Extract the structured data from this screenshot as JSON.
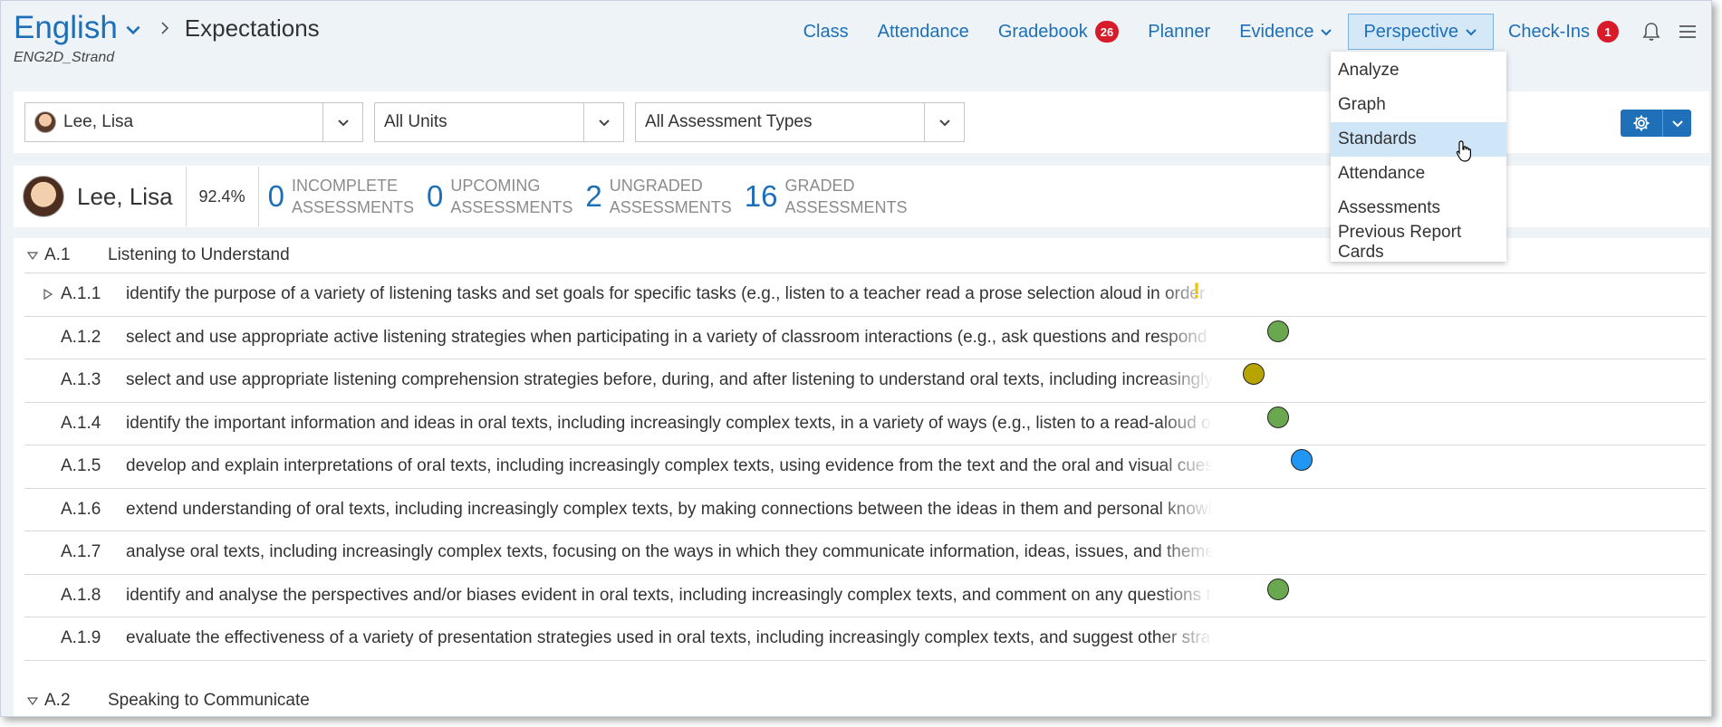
{
  "header": {
    "course_name": "English",
    "page_title": "Expectations",
    "course_code": "ENG2D_Strand"
  },
  "nav": {
    "class": "Class",
    "attendance": "Attendance",
    "gradebook": "Gradebook",
    "gradebook_badge": "26",
    "planner": "Planner",
    "evidence": "Evidence",
    "perspective": "Perspective",
    "checkins": "Check-Ins",
    "checkins_badge": "1"
  },
  "perspective_menu": {
    "items": [
      "Analyze",
      "Graph",
      "Standards",
      "Attendance",
      "Assessments",
      "Previous Report Cards"
    ],
    "selected": "Standards"
  },
  "filters": {
    "student": "Lee, Lisa",
    "units": "All Units",
    "assessment_types": "All Assessment Types"
  },
  "summary": {
    "student_name": "Lee, Lisa",
    "percent": "92.4%",
    "stats": [
      {
        "num": "0",
        "line1": "INCOMPLETE",
        "line2": "ASSESSMENTS"
      },
      {
        "num": "0",
        "line1": "UPCOMING",
        "line2": "ASSESSMENTS"
      },
      {
        "num": "2",
        "line1": "UNGRADED",
        "line2": "ASSESSMENTS"
      },
      {
        "num": "16",
        "line1": "GRADED",
        "line2": "ASSESSMENTS"
      }
    ]
  },
  "strands": [
    {
      "code": "A.1",
      "title": "Listening to Understand"
    },
    {
      "code": "A.2",
      "title": "Speaking to Communicate"
    }
  ],
  "expectations": [
    {
      "code": "A.1.1",
      "expandable": true,
      "text": "identify the purpose of a variety of listening tasks and set goals for specific tasks (e.g., listen to a teacher read a prose selection aloud in order to identify how the",
      "marker": "warning"
    },
    {
      "code": "A.1.2",
      "text": "select and use appropriate active listening strategies when participating in a variety of classroom interactions (e.g., ask questions and respond to the ideas of others",
      "marker": "green"
    },
    {
      "code": "A.1.3",
      "text": "select and use appropriate listening comprehension strategies before, during, and after listening to understand oral texts, including increasingly complex texts (e.g.",
      "marker": "olive"
    },
    {
      "code": "A.1.4",
      "text": "identify the important information and ideas in oral texts, including increasingly complex texts, in a variety of ways (e.g., listen to a read-aloud of a scene from a S",
      "marker": "green"
    },
    {
      "code": "A.1.5",
      "text": "develop and explain interpretations of oral texts, including increasingly complex texts, using evidence from the text and the oral and visual cues used in it to supp",
      "marker": "blue"
    },
    {
      "code": "A.1.6",
      "text": "extend understanding of oral texts, including increasingly complex texts, by making connections between the ideas in them and personal knowledge, experience,",
      "marker": ""
    },
    {
      "code": "A.1.7",
      "text": "analyse oral texts, including increasingly complex texts, focusing on the ways in which they communicate information, ideas, issues, and themes and influence the",
      "marker": ""
    },
    {
      "code": "A.1.8",
      "text": "identify and analyse the perspectives and/or biases evident in oral texts, including increasingly complex texts, and comment on any questions they may raise abou",
      "marker": "green"
    },
    {
      "code": "A.1.9",
      "text": "evaluate the effectiveness of a variety of presentation strategies used in oral texts, including increasingly complex texts, and suggest other strategies that could b",
      "marker": ""
    }
  ],
  "colors": {
    "accent": "#1d6fb8",
    "green": "#6aa84f",
    "olive": "#b8a400",
    "blue": "#2196f3",
    "warning": "#f2c200",
    "badge": "#d81b2a"
  }
}
